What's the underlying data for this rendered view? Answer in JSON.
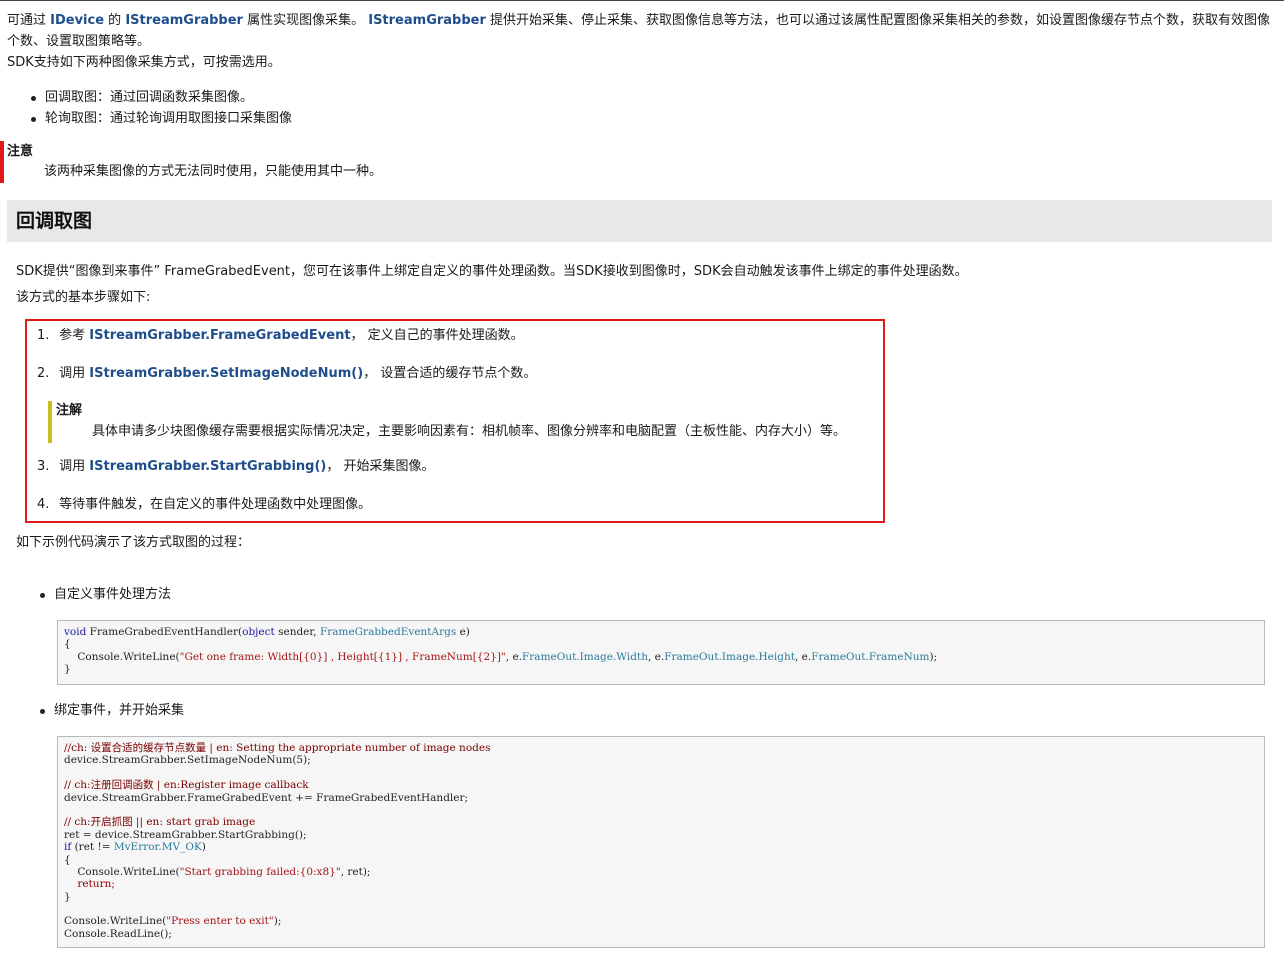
{
  "intro": {
    "line1_pre": "可通过 ",
    "idevice": "IDevice",
    "line1_mid": " 的 ",
    "grabber1": "IStreamGrabber",
    "line1_mid2": " 属性实现图像采集。 ",
    "grabber2": "IStreamGrabber",
    "line1_post": " 提供开始采集、停止采集、获取图像信息等方法，也可以通过该属性配置图像采集相关的参数，如设置图像缓存节点个数，获取有效图像",
    "line2": "个数、设置取图策略等。",
    "line3": "SDK支持如下两种图像采集方式，可按需选用。"
  },
  "modes": [
    "回调取图：通过回调函数采集图像。",
    "轮询取图：通过轮询调用取图接口采集图像"
  ],
  "note": {
    "title": "注意",
    "text": "该两种采集图像的方式无法同时使用，只能使用其中一种。"
  },
  "section": {
    "title": "回调取图"
  },
  "desc": {
    "line1": "SDK提供“图像到来事件” FrameGrabedEvent，您可在该事件上绑定自定义的事件处理函数。当SDK接收到图像时，SDK会自动触发该事件上绑定的事件处理函数。",
    "line2": "该方式的基本步骤如下:"
  },
  "steps": {
    "s1": {
      "num": "1.",
      "pre": "参考 ",
      "link": "IStreamGrabber.FrameGrabedEvent",
      "post": "， 定义自己的事件处理函数。"
    },
    "s2": {
      "num": "2.",
      "pre": "调用 ",
      "link": "IStreamGrabber.SetImageNodeNum()",
      "post": "， 设置合适的缓存节点个数。"
    },
    "annotation": {
      "title": "注解",
      "text": "具体申请多少块图像缓存需要根据实际情况决定，主要影响因素有：相机帧率、图像分辨率和电脑配置（主板性能、内存大小）等。"
    },
    "s3": {
      "num": "3.",
      "pre": "调用 ",
      "link": "IStreamGrabber.StartGrabbing()",
      "post": "， 开始采集图像。"
    },
    "s4": {
      "num": "4.",
      "text": "等待事件触发，在自定义的事件处理函数中处理图像。"
    }
  },
  "example_intro": "如下示例代码演示了该方式取图的过程：",
  "examples": {
    "handler_label": "自定义事件处理方法",
    "bind_label": "绑定事件，并开始采集"
  },
  "code1": {
    "l1_a": "void",
    "l1_b": " FrameGrabedEventHandler(",
    "l1_c": "object",
    "l1_d": " sender, ",
    "l1_e": "FrameGrabbedEventArgs",
    "l1_f": " e)",
    "l2": "{",
    "l3_a": "    Console.WriteLine(",
    "l3_b": "\"Get one frame: Width[{0}] , Height[{1}] , FrameNum[{2}]\"",
    "l3_c": ", e.",
    "l3_d": "FrameOut.Image.Width",
    "l3_e": ", e.",
    "l3_f": "FrameOut.Image.Height",
    "l3_g": ", e.",
    "l3_h": "FrameOut.FrameNum",
    "l3_i": ");",
    "l4": "}"
  },
  "code2": {
    "c1": "//ch: 设置合适的缓存节点数量 | en: Setting the appropriate number of image nodes",
    "l1": "device.StreamGrabber.SetImageNodeNum(5);",
    "c2": "// ch:注册回调函数 | en:Register image callback",
    "l2": "device.StreamGrabber.FrameGrabedEvent += FrameGrabedEventHandler;",
    "c3": "// ch:开启抓图 || en: start grab image",
    "l3": "ret = device.StreamGrabber.StartGrabbing();",
    "l4_a": "if",
    "l4_b": " (ret != ",
    "l4_c": "MvError.MV_OK",
    "l4_d": ")",
    "l5": "{",
    "l6_a": "    Console.WriteLine(",
    "l6_b": "\"Start grabbing failed:{0:x8}\"",
    "l6_c": ", ret);",
    "l7": "    return;",
    "l8": "}",
    "l9_a": "Console.WriteLine(",
    "l9_b": "\"Press enter to exit\"",
    "l9_c": ");",
    "l10": "Console.ReadLine();"
  }
}
